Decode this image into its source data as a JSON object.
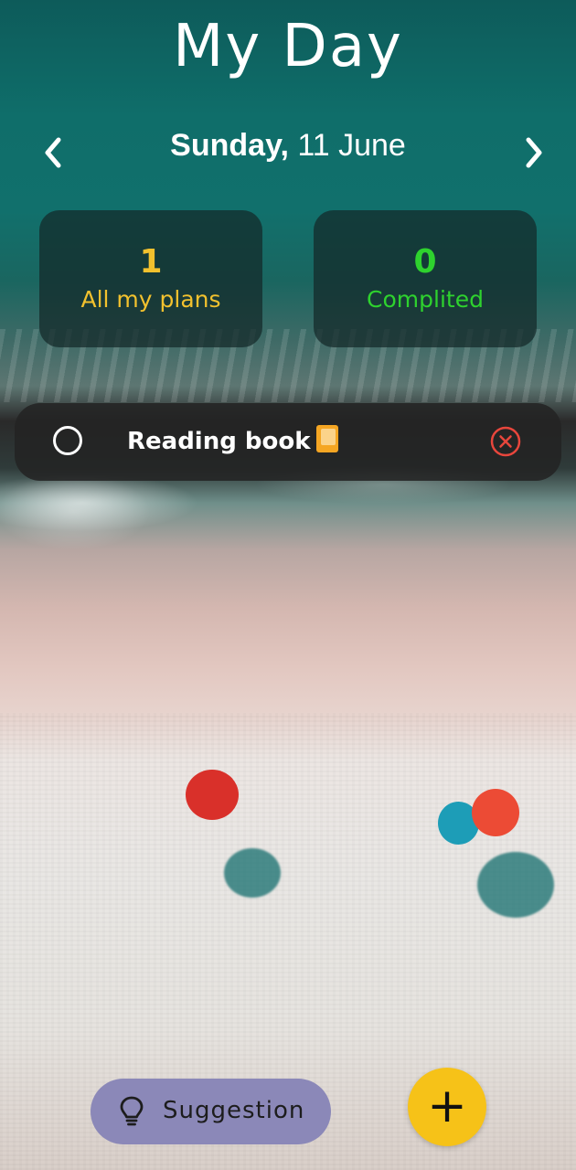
{
  "header": {
    "title": "My Day",
    "date_weekday": "Sunday,",
    "date_rest": " 11 June",
    "prev_icon": "chevron-left-icon",
    "next_icon": "chevron-right-icon"
  },
  "stats": {
    "all_plans": {
      "count": "1",
      "label": "All my plans",
      "color": "#f2c12e"
    },
    "completed": {
      "count": "0",
      "label": "Complited",
      "color": "#2ed22e"
    }
  },
  "tasks": [
    {
      "text": "Reading book",
      "icon": "book-icon",
      "completed": false,
      "delete_color": "#e8463c"
    }
  ],
  "footer": {
    "suggestion_label": "Suggestion",
    "suggestion_icon": "lightbulb-icon",
    "add_label": "+",
    "fab_color": "#f6c218"
  }
}
